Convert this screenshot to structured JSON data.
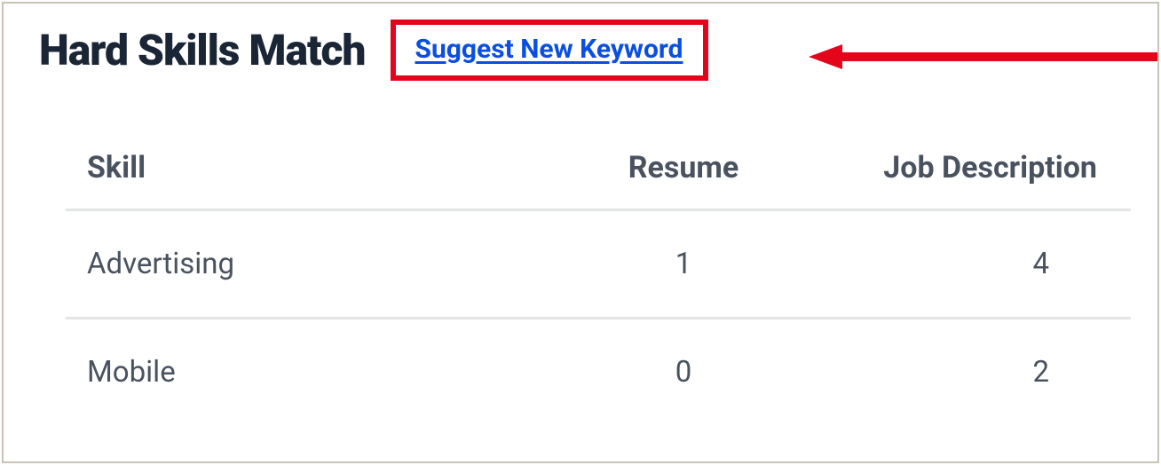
{
  "header": {
    "title": "Hard Skills Match",
    "suggest_link": "Suggest New Keyword"
  },
  "table": {
    "columns": {
      "skill": "Skill",
      "resume": "Resume",
      "job_description": "Job Description"
    },
    "rows": [
      {
        "skill": "Advertising",
        "resume": "1",
        "job_description": "4"
      },
      {
        "skill": "Mobile",
        "resume": "0",
        "job_description": "2"
      }
    ]
  },
  "annotation": {
    "arrow_color": "#e3061a",
    "highlight_color": "#e3061a"
  }
}
